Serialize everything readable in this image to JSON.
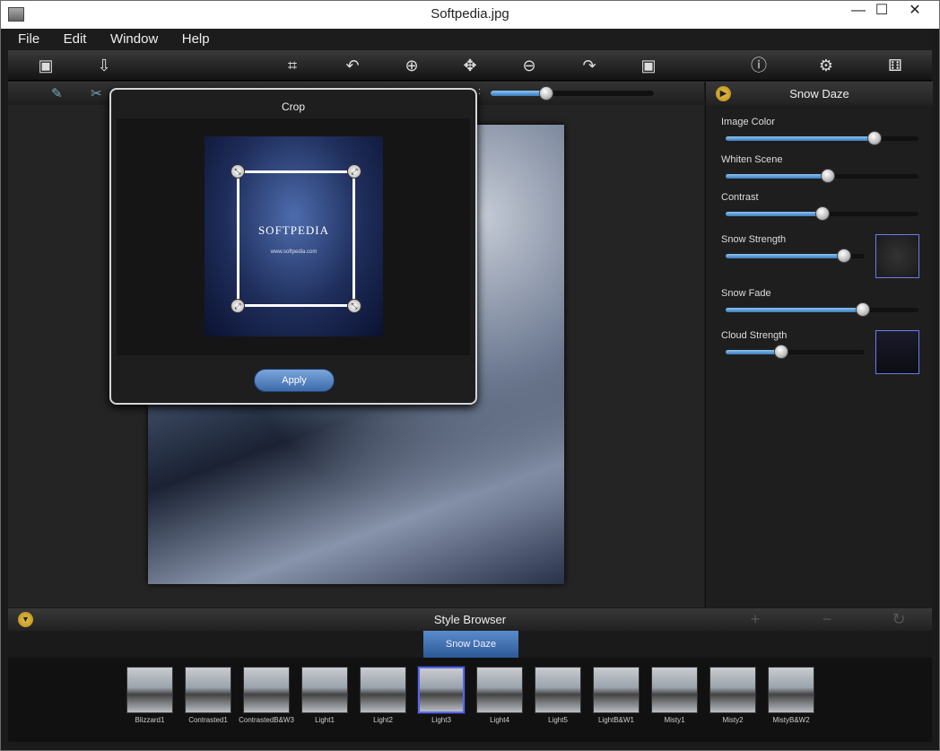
{
  "window": {
    "title": "Softpedia.jpg",
    "minimize": "—",
    "maximize": "☐",
    "close": "✕"
  },
  "menu": [
    "File",
    "Edit",
    "Window",
    "Help"
  ],
  "toolbar_icons": [
    "image-open-icon",
    "import-icon",
    "crop-icon",
    "rotate-left-icon",
    "zoom-in-icon",
    "move-icon",
    "zoom-out-icon",
    "rotate-right-icon",
    "fit-image-icon",
    "info-icon",
    "settings-icon",
    "random-icon"
  ],
  "zoom": {
    "label": ":",
    "value": 0.34
  },
  "crop_dialog": {
    "title": "Crop",
    "image_brand": "SOFTPEDIA",
    "image_url": "www.softpedia.com",
    "apply_label": "Apply"
  },
  "panel": {
    "title": "Snow Daze",
    "params": [
      {
        "label": "Image Color",
        "value": 0.77
      },
      {
        "label": "Whiten Scene",
        "value": 0.53
      },
      {
        "label": "Contrast",
        "value": 0.5
      },
      {
        "label": "Snow Strength",
        "value": 0.85
      },
      {
        "label": "Snow Fade",
        "value": 0.71
      },
      {
        "label": "Cloud Strength",
        "value": 0.4
      }
    ]
  },
  "style_browser": {
    "title": "Style Browser",
    "active_tab": "Snow Daze",
    "styles": [
      "Blizzard1",
      "Contrasted1",
      "ContrastedB&W3",
      "Light1",
      "Light2",
      "Light3",
      "Light4",
      "Light5",
      "LightB&W1",
      "Misty1",
      "Misty2",
      "MistyB&W2"
    ],
    "selected": "Light3"
  }
}
